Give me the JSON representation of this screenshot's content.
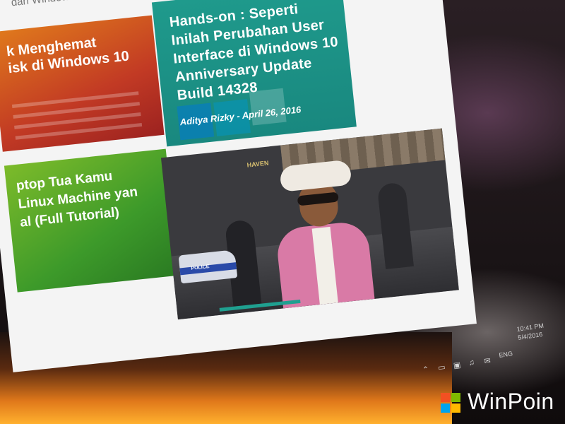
{
  "screen": {
    "top_strip_text": "dari Windows Store (Video)",
    "card_orange_title": "k Menghemat\nisk di Windows 10",
    "card_teal_title": "Hands-on : Seperti Inilah Perubahan User Interface di Windows 10 Anniversary Update Build 14328",
    "card_teal_author": "Aditya Rizky",
    "card_teal_date": "April 26, 2016",
    "card_green_title": "ptop Tua Kamu\nLinux Machine yan\nal (Full Tutorial)",
    "video_car_label": "POLICE",
    "video_sign": "HAVEN"
  },
  "tray": {
    "time": "10:41 PM",
    "date": "5/4/2016",
    "language": "ENG"
  },
  "brand": {
    "name": "WinPoin",
    "logo_colors": [
      "#f25022",
      "#7fba00",
      "#00a4ef",
      "#ffb900"
    ]
  }
}
